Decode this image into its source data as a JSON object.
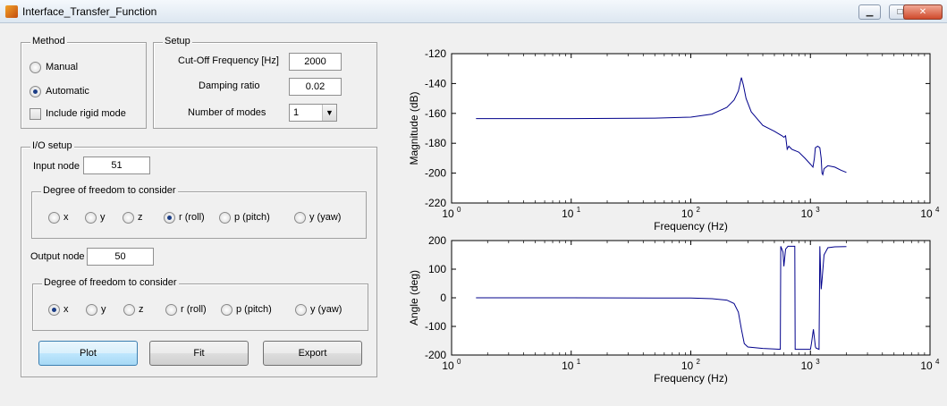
{
  "window": {
    "title": "Interface_Transfer_Function"
  },
  "method": {
    "title": "Method",
    "manual_label": "Manual",
    "automatic_label": "Automatic",
    "rigid_label": "Include rigid mode"
  },
  "setup": {
    "title": "Setup",
    "cutoff_label": "Cut-Off Frequency [Hz]",
    "cutoff_value": "2000",
    "damping_label": "Damping ratio",
    "damping_value": "0.02",
    "modes_label": "Number of modes",
    "modes_value": "1"
  },
  "io": {
    "title": "I/O setup",
    "input_label": "Input node",
    "input_value": "51",
    "output_label": "Output node",
    "output_value": "50",
    "dof_title": "Degree of freedom to consider",
    "dof_labels": [
      "x",
      "y",
      "z",
      "r (roll)",
      "p  (pitch)",
      "y (yaw)"
    ],
    "input_selected": "r (roll)",
    "output_selected": "x"
  },
  "buttons": {
    "plot": "Plot",
    "fit": "Fit",
    "export": "Export"
  },
  "chart_data": [
    {
      "type": "line",
      "xscale": "log",
      "xlim": [
        1,
        10000
      ],
      "ylim": [
        -220,
        -120
      ],
      "xlabel": "Frequency (Hz)",
      "ylabel": "Magnitude (dB)",
      "xtick_labels": [
        "10",
        "10",
        "10",
        "10",
        "10"
      ],
      "xtick_exponents": [
        "0",
        "1",
        "2",
        "3",
        "4"
      ],
      "ytick_labels": [
        "-120",
        "-140",
        "-160",
        "-180",
        "-200",
        "-220"
      ],
      "ytick_values": [
        -120,
        -140,
        -160,
        -180,
        -200,
        -220
      ],
      "color": "#00008b",
      "x": [
        1.6,
        10,
        50,
        100,
        150,
        200,
        230,
        250,
        265,
        275,
        290,
        320,
        400,
        500,
        580,
        600,
        620,
        640,
        660,
        700,
        800,
        900,
        1000,
        1050,
        1080,
        1100,
        1150,
        1200,
        1230,
        1250,
        1270,
        1300,
        1400,
        1600,
        1800,
        2000
      ],
      "y": [
        -163.5,
        -163.5,
        -163.2,
        -162.5,
        -160.5,
        -156,
        -151,
        -145,
        -136,
        -141,
        -150,
        -159,
        -168,
        -172,
        -175,
        -176,
        -175,
        -184,
        -182,
        -184,
        -186,
        -190,
        -194,
        -196,
        -190,
        -183,
        -182,
        -183,
        -190,
        -200,
        -201,
        -197,
        -195,
        -196,
        -198,
        -199.5
      ]
    },
    {
      "type": "line",
      "xscale": "log",
      "xlim": [
        1,
        10000
      ],
      "ylim": [
        -200,
        200
      ],
      "xlabel": "Frequency (Hz)",
      "ylabel": "Angle (deg)",
      "xtick_labels": [
        "10",
        "10",
        "10",
        "10",
        "10"
      ],
      "xtick_exponents": [
        "0",
        "1",
        "2",
        "3",
        "4"
      ],
      "ytick_labels": [
        "200",
        "100",
        "0",
        "-100",
        "-200"
      ],
      "ytick_values": [
        200,
        100,
        0,
        -100,
        -200
      ],
      "color": "#00008b",
      "x": [
        1.6,
        10,
        50,
        100,
        150,
        200,
        230,
        250,
        265,
        280,
        300,
        400,
        500,
        560,
        565,
        590,
        600,
        620,
        650,
        700,
        740,
        745,
        1000,
        1020,
        1060,
        1100,
        1110,
        1150,
        1180,
        1200,
        1220,
        1230,
        1250,
        1300,
        1400,
        1600,
        2000
      ],
      "y": [
        0,
        0,
        -0.5,
        -1,
        -3,
        -8,
        -20,
        -50,
        -110,
        -160,
        -172,
        -177,
        -179,
        -180,
        180,
        160,
        110,
        170,
        180,
        180,
        180,
        -180,
        -180,
        -160,
        -110,
        -170,
        -175,
        -178,
        -180,
        180,
        80,
        30,
        60,
        150,
        175,
        178,
        179
      ]
    }
  ]
}
